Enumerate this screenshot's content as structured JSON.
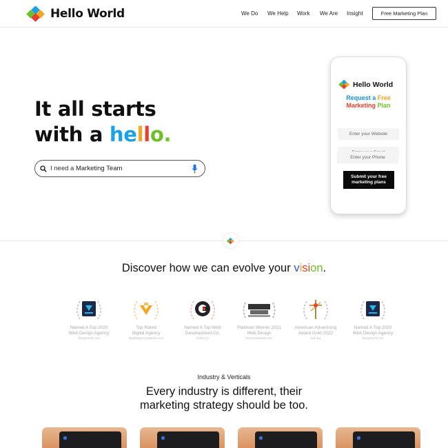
{
  "header": {
    "brand": "Hello World",
    "nav": [
      "We Do",
      "We Help",
      "Work",
      "We Are",
      "Insight"
    ],
    "cta_label": "Free Marketing Plan"
  },
  "hero": {
    "title_line1": "It all starts",
    "title_line2_prefix": "with a",
    "hello_letters": [
      "h",
      "e",
      "l",
      "l",
      "o",
      "."
    ],
    "hello_colors": [
      "#1aa1e6",
      "#1aa1e6",
      "#f5a623",
      "#e8402e",
      "#6fbf2b",
      "#6fbf2b"
    ],
    "search_prefix": "I need a",
    "search_value": "Marketing Team"
  },
  "phone": {
    "brand": "Hello World",
    "request_line1_a": "Request a",
    "request_line1_b": "Free",
    "request_line2_a": "Marketing",
    "request_line2_b": "Plan",
    "field_website": "Enter your Website",
    "field_email": "Enter your Email",
    "field_phone": "Enter your Phone",
    "submit_line1": "Submit your free",
    "submit_line2": "marketing plans"
  },
  "discover": {
    "prefix": "Discover how we can evolve your",
    "vision_letters": [
      "v",
      "i",
      "s",
      "i",
      "o",
      "n"
    ],
    "suffix": "."
  },
  "awards": [
    {
      "line1": "Named A Top 2020",
      "line2": "Web Design Agency",
      "src": "designrush.com",
      "icon": "designrush-badge-icon"
    },
    {
      "line1": "Top Rated",
      "line2": "Digital Agency",
      "src": "digitalagencyawards.com",
      "icon": "top-rated-badge-icon"
    },
    {
      "line1": "Named A Top Web",
      "line2": "Development Co.",
      "src": "clutch.co",
      "icon": "clutch-badge-icon"
    },
    {
      "line1": "Platinum Winner 2021",
      "line2": "Web Design",
      "src": "hermesawards.com",
      "icon": "hermes-badge-icon"
    },
    {
      "line1": "American Advertising",
      "line2": "Award Gold 2022",
      "src": "aaf.org",
      "icon": "addy-award-icon"
    },
    {
      "line1": "Named A Top 2020",
      "line2": "Web Design Agency",
      "src": "designrush.com",
      "icon": "designrush-badge-icon"
    }
  ],
  "industry": {
    "label": "Industry & Verticals",
    "title_line1": "Every industry is different, their",
    "title_line2": "marketing strategy should be too."
  },
  "colors": {
    "blue": "#1aa1e6",
    "orange": "#f5a623",
    "red": "#e8402e",
    "green": "#6fbf2b"
  }
}
